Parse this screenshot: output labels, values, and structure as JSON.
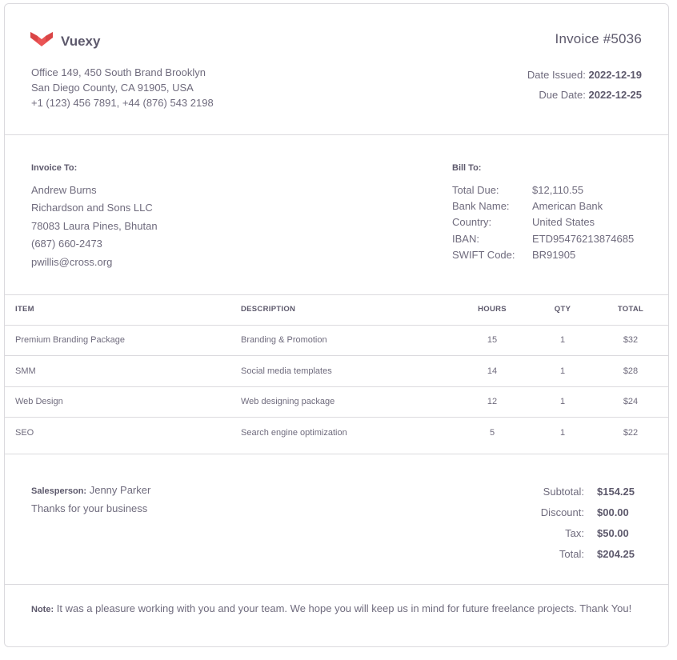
{
  "company": {
    "name": "Vuexy",
    "address_lines": [
      "Office 149, 450 South Brand Brooklyn",
      "San Diego County, CA 91905, USA",
      "+1 (123) 456 7891, +44 (876) 543 2198"
    ]
  },
  "invoice": {
    "title": "Invoice #5036",
    "date_issued_label": "Date Issued:",
    "date_issued": "2022-12-19",
    "due_date_label": "Due Date:",
    "due_date": "2022-12-25"
  },
  "invoice_to": {
    "heading": "Invoice To:",
    "lines": [
      "Andrew Burns",
      "Richardson and Sons LLC",
      "78083 Laura Pines, Bhutan",
      "(687) 660-2473",
      "pwillis@cross.org"
    ]
  },
  "bill_to": {
    "heading": "Bill To:",
    "rows": [
      {
        "label": "Total Due:",
        "value": "$12,110.55"
      },
      {
        "label": "Bank Name:",
        "value": "American Bank"
      },
      {
        "label": "Country:",
        "value": "United States"
      },
      {
        "label": "IBAN:",
        "value": "ETD95476213874685"
      },
      {
        "label": "SWIFT Code:",
        "value": "BR91905"
      }
    ]
  },
  "items_table": {
    "headers": {
      "item": "ITEM",
      "description": "DESCRIPTION",
      "hours": "HOURS",
      "qty": "QTY",
      "total": "TOTAL"
    },
    "rows": [
      {
        "item": "Premium Branding Package",
        "description": "Branding & Promotion",
        "hours": "15",
        "qty": "1",
        "total": "$32"
      },
      {
        "item": "SMM",
        "description": "Social media templates",
        "hours": "14",
        "qty": "1",
        "total": "$28"
      },
      {
        "item": "Web Design",
        "description": "Web designing package",
        "hours": "12",
        "qty": "1",
        "total": "$24"
      },
      {
        "item": "SEO",
        "description": "Search engine optimization",
        "hours": "5",
        "qty": "1",
        "total": "$22"
      }
    ]
  },
  "salesperson": {
    "label": "Salesperson:",
    "name": "Jenny Parker",
    "thanks": "Thanks for your business"
  },
  "totals": {
    "rows": [
      {
        "label": "Subtotal:",
        "value": "$154.25"
      },
      {
        "label": "Discount:",
        "value": "$00.00"
      },
      {
        "label": "Tax:",
        "value": "$50.00"
      },
      {
        "label": "Total:",
        "value": "$204.25"
      }
    ]
  },
  "note": {
    "label": "Note:",
    "text": "It was a pleasure working with you and your team. We hope you will keep us in mind for future freelance projects. Thank You!"
  },
  "colors": {
    "brand": "#ea5455",
    "border": "#dbdade"
  },
  "icons": {
    "logo": "vuexy-logo-icon"
  }
}
